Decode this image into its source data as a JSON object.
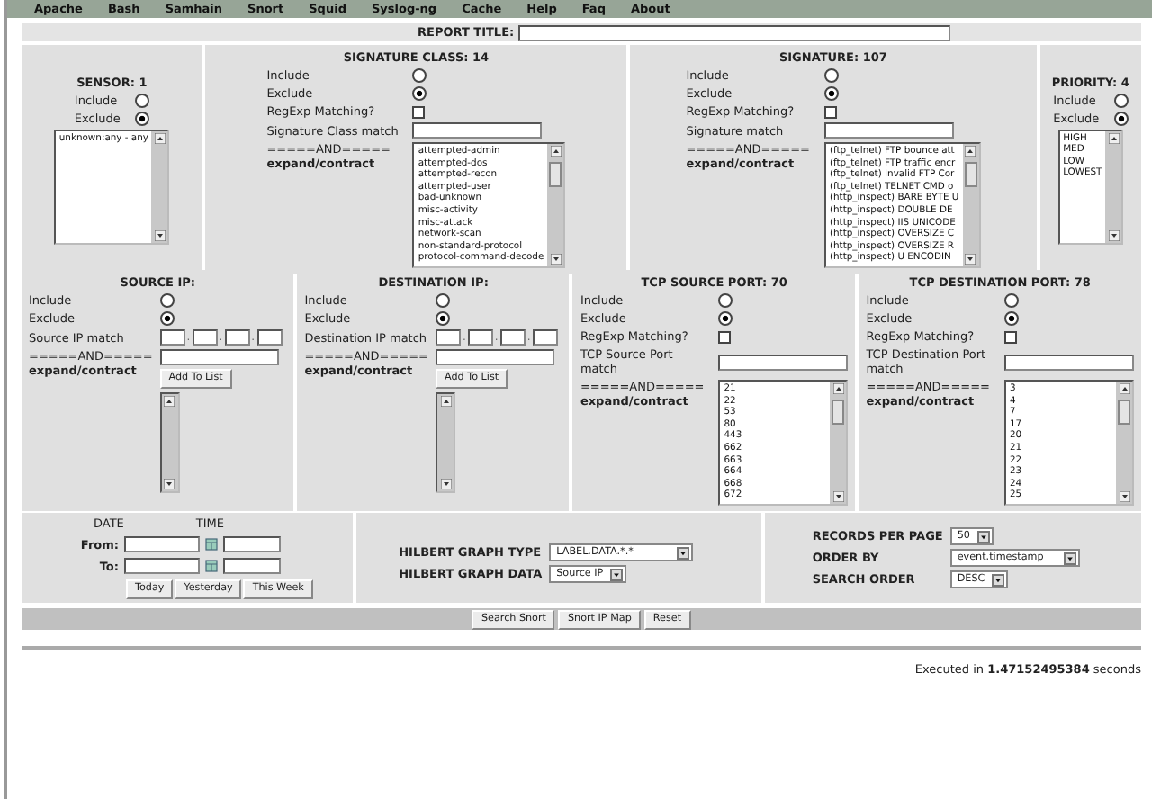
{
  "menu": [
    "Apache",
    "Bash",
    "Samhain",
    "Snort",
    "Squid",
    "Syslog-ng",
    "Cache",
    "Help",
    "Faq",
    "About"
  ],
  "report_title_label": "REPORT TITLE:",
  "top_filters": [
    {
      "kind": "sensor",
      "title": "SENSOR: 1",
      "options": [
        {
          "label": "Include",
          "selected": false
        },
        {
          "label": "Exclude",
          "selected": true
        }
      ],
      "items": [
        "unknown:any - any"
      ]
    },
    {
      "kind": "list",
      "title": "SIGNATURE CLASS: 14",
      "options": [
        {
          "label": "Include",
          "selected": false
        },
        {
          "label": "Exclude",
          "selected": true
        }
      ],
      "regexp": {
        "label": "RegExp Matching?",
        "checked": false
      },
      "match_label": "Signature Class match",
      "and_label": "=====AND=====",
      "expand_label": "expand/contract",
      "items": [
        "attempted-admin",
        "attempted-dos",
        "attempted-recon",
        "attempted-user",
        "bad-unknown",
        "misc-activity",
        "misc-attack",
        "network-scan",
        "non-standard-protocol",
        "protocol-command-decode"
      ]
    },
    {
      "kind": "list",
      "title": "SIGNATURE: 107",
      "options": [
        {
          "label": "Include",
          "selected": false
        },
        {
          "label": "Exclude",
          "selected": true
        }
      ],
      "regexp": {
        "label": "RegExp Matching?",
        "checked": false
      },
      "match_label": "Signature match",
      "and_label": "=====AND=====",
      "expand_label": "expand/contract",
      "items": [
        "(ftp_telnet) FTP bounce att",
        "(ftp_telnet) FTP traffic encr",
        "(ftp_telnet) Invalid FTP Cor",
        "(ftp_telnet) TELNET CMD o",
        "(http_inspect) BARE BYTE U",
        "(http_inspect) DOUBLE DE",
        "(http_inspect) IIS UNICODE",
        "(http_inspect) OVERSIZE C",
        "(http_inspect) OVERSIZE R",
        "(http_inspect) U ENCODIN"
      ]
    },
    {
      "kind": "sensor",
      "title": "PRIORITY: 4",
      "options": [
        {
          "label": "Include",
          "selected": false
        },
        {
          "label": "Exclude",
          "selected": true
        }
      ],
      "items": [
        "HIGH",
        "MED",
        "LOW",
        "LOWEST"
      ]
    }
  ],
  "middle_filters": [
    {
      "kind": "ip",
      "title": "SOURCE IP:",
      "options": [
        {
          "label": "Include",
          "selected": false
        },
        {
          "label": "Exclude",
          "selected": true
        }
      ],
      "match_label": "Source IP match",
      "separators": [
        ".",
        ".",
        "."
      ],
      "and_label": "=====AND=====",
      "expand_label": "expand/contract",
      "add_button": "Add To List"
    },
    {
      "kind": "ip",
      "title": "DESTINATION IP:",
      "options": [
        {
          "label": "Include",
          "selected": false
        },
        {
          "label": "Exclude",
          "selected": true
        }
      ],
      "match_label": "Destination IP match",
      "separators": [
        ".",
        ".",
        "."
      ],
      "and_label": "=====AND=====",
      "expand_label": "expand/contract",
      "add_button": "Add To List"
    },
    {
      "kind": "list",
      "title": "TCP SOURCE PORT: 70",
      "options": [
        {
          "label": "Include",
          "selected": false
        },
        {
          "label": "Exclude",
          "selected": true
        }
      ],
      "regexp": {
        "label": "RegExp Matching?",
        "checked": false
      },
      "match_label": "TCP Source Port match",
      "and_label": "=====AND=====",
      "expand_label": "expand/contract",
      "items": [
        "21",
        "22",
        "53",
        "80",
        "443",
        "662",
        "663",
        "664",
        "668",
        "672"
      ]
    },
    {
      "kind": "list",
      "title": "TCP DESTINATION PORT: 78",
      "options": [
        {
          "label": "Include",
          "selected": false
        },
        {
          "label": "Exclude",
          "selected": true
        }
      ],
      "regexp": {
        "label": "RegExp Matching?",
        "checked": false
      },
      "match_label": "TCP Destination Port match",
      "and_label": "=====AND=====",
      "expand_label": "expand/contract",
      "items": [
        "3",
        "4",
        "7",
        "17",
        "20",
        "21",
        "22",
        "23",
        "24",
        "25"
      ]
    }
  ],
  "date": {
    "headers": [
      "DATE",
      "TIME"
    ],
    "rows": [
      {
        "label": "From:"
      },
      {
        "label": "To:"
      }
    ],
    "buttons": [
      "Today",
      "Yesterday",
      "This Week"
    ]
  },
  "hilbert": [
    {
      "label": "HILBERT GRAPH TYPE",
      "value": "LABEL.DATA.*.*"
    },
    {
      "label": "HILBERT GRAPH DATA",
      "value": "Source IP"
    }
  ],
  "paging": [
    {
      "label": "RECORDS PER PAGE",
      "value": "50"
    },
    {
      "label": "ORDER BY",
      "value": "event.timestamp"
    },
    {
      "label": "SEARCH ORDER",
      "value": "DESC"
    }
  ],
  "actions": [
    "Search Snort",
    "Snort IP Map",
    "Reset"
  ],
  "footer": "Executed in **1.47152495384** seconds"
}
